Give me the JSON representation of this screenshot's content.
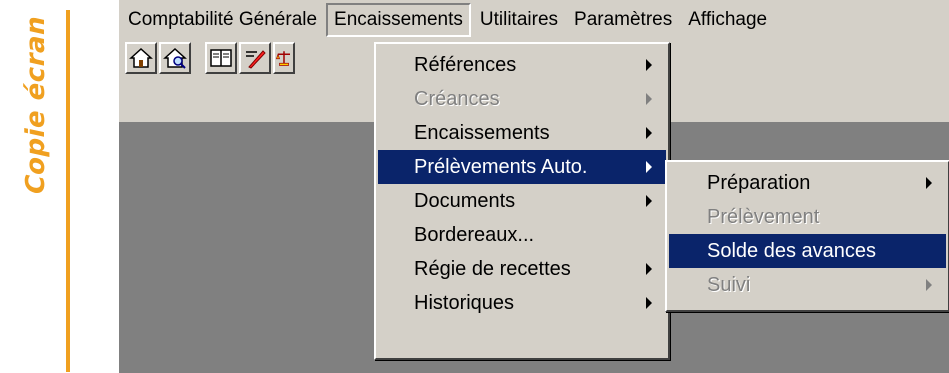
{
  "side_caption": "Copie écran",
  "menubar": {
    "items": [
      "Comptabilité Générale",
      "Encaissements",
      "Utilitaires",
      "Paramètres",
      "Affichage"
    ]
  },
  "toolbar": {
    "buttons": [
      "home-icon",
      "home-search-icon",
      "book-icon",
      "pen-edit-icon",
      "scale-icon"
    ]
  },
  "encaissements_menu": {
    "items": [
      {
        "label": "Références",
        "submenu": true,
        "enabled": true
      },
      {
        "label": "Créances",
        "submenu": true,
        "enabled": false
      },
      {
        "label": "Encaissements",
        "submenu": true,
        "enabled": true
      },
      {
        "label": "Prélèvements Auto.",
        "submenu": true,
        "enabled": true,
        "highlighted": true
      },
      {
        "label": "Documents",
        "submenu": true,
        "enabled": true
      },
      {
        "label": "Bordereaux...",
        "submenu": false,
        "enabled": true
      },
      {
        "label": "Régie de recettes",
        "submenu": true,
        "enabled": true
      },
      {
        "label": "Historiques",
        "submenu": true,
        "enabled": true
      }
    ]
  },
  "prelevements_submenu": {
    "items": [
      {
        "label": "Préparation",
        "submenu": true,
        "enabled": true
      },
      {
        "label": "Prélèvement",
        "submenu": false,
        "enabled": false
      },
      {
        "label": "Solde des avances",
        "submenu": false,
        "enabled": true,
        "highlighted": true
      },
      {
        "label": "Suivi",
        "submenu": true,
        "enabled": false
      }
    ]
  },
  "colors": {
    "accent_orange": "#f0a020",
    "menu_bg": "#d4d0c8",
    "highlight": "#0a246a",
    "workspace": "#808080"
  }
}
